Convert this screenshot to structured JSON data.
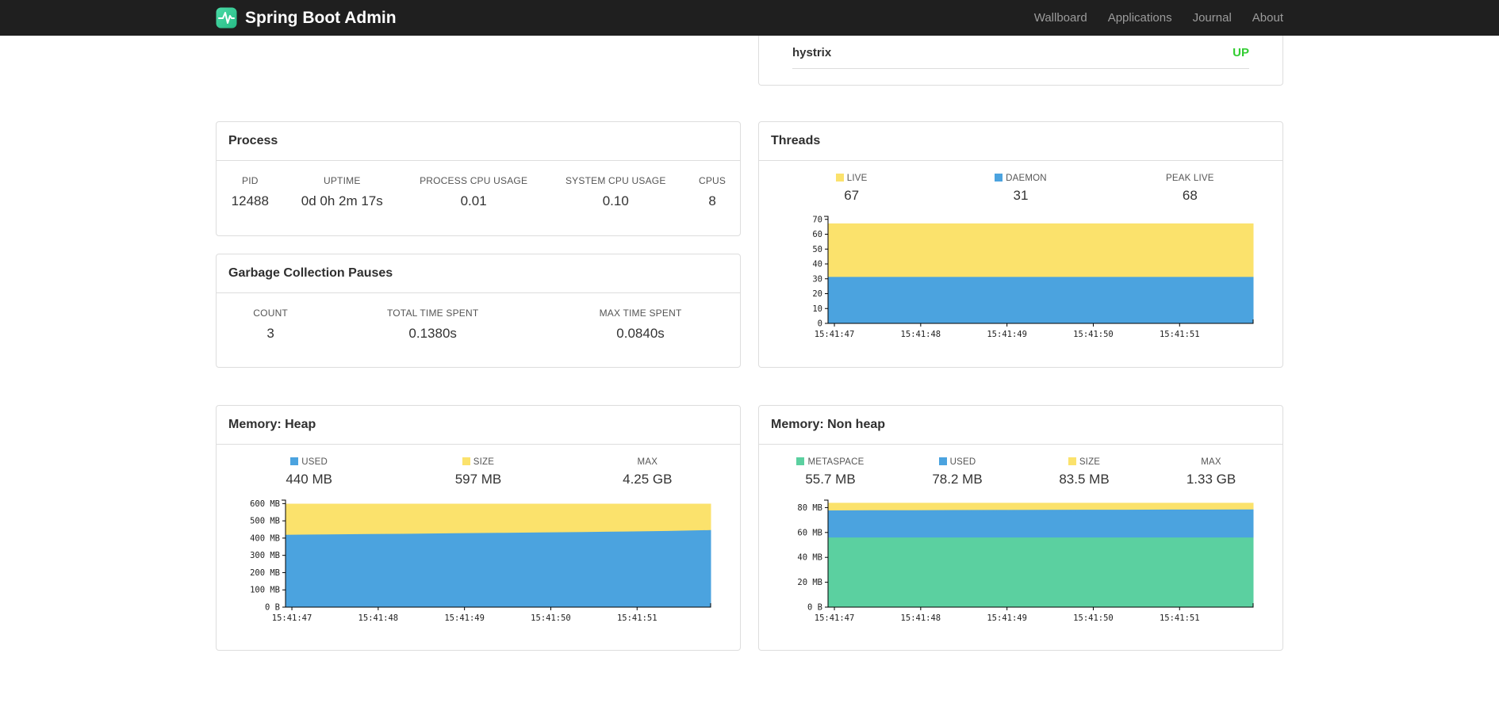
{
  "colors": {
    "navbar_bg": "#1f1f1f",
    "status_up": "#32CD32",
    "panel_border": "#dddddd",
    "chart_blue": "#4BA3DF",
    "chart_yellow": "#FBE26C",
    "chart_green": "#5BD0A0"
  },
  "navbar": {
    "brand": "Spring Boot Admin",
    "links": [
      {
        "label": "Wallboard"
      },
      {
        "label": "Applications"
      },
      {
        "label": "Journal"
      },
      {
        "label": "About"
      }
    ]
  },
  "health_panel": {
    "items": [
      {
        "name": "hystrix",
        "status": "UP"
      }
    ]
  },
  "process_panel": {
    "title": "Process",
    "stats": [
      {
        "label": "PID",
        "value": "12488"
      },
      {
        "label": "UPTIME",
        "value": "0d 0h 2m 17s"
      },
      {
        "label": "PROCESS CPU USAGE",
        "value": "0.01"
      },
      {
        "label": "SYSTEM CPU USAGE",
        "value": "0.10"
      },
      {
        "label": "CPUS",
        "value": "8"
      }
    ]
  },
  "gc_panel": {
    "title": "Garbage Collection Pauses",
    "stats": [
      {
        "label": "COUNT",
        "value": "3"
      },
      {
        "label": "TOTAL TIME SPENT",
        "value": "0.1380s"
      },
      {
        "label": "MAX TIME SPENT",
        "value": "0.0840s"
      }
    ]
  },
  "threads_panel": {
    "title": "Threads",
    "legend": [
      {
        "label": "LIVE",
        "value": "67",
        "swatch": "#FBE26C"
      },
      {
        "label": "DAEMON",
        "value": "31",
        "swatch": "#4BA3DF"
      },
      {
        "label": "PEAK LIVE",
        "value": "68"
      }
    ]
  },
  "heap_panel": {
    "title": "Memory: Heap",
    "legend": [
      {
        "label": "USED",
        "value": "440 MB",
        "swatch": "#4BA3DF"
      },
      {
        "label": "SIZE",
        "value": "597 MB",
        "swatch": "#FBE26C"
      },
      {
        "label": "MAX",
        "value": "4.25 GB"
      }
    ]
  },
  "nonheap_panel": {
    "title": "Memory: Non heap",
    "legend": [
      {
        "label": "METASPACE",
        "value": "55.7 MB",
        "swatch": "#5BD0A0"
      },
      {
        "label": "USED",
        "value": "78.2 MB",
        "swatch": "#4BA3DF"
      },
      {
        "label": "SIZE",
        "value": "83.5 MB",
        "swatch": "#FBE26C"
      },
      {
        "label": "MAX",
        "value": "1.33 GB"
      }
    ]
  },
  "chart_data": [
    {
      "id": "threads-chart",
      "type": "area",
      "title": "Threads",
      "legend_position": "top",
      "grid": false,
      "ymax": 72,
      "y_ticks": [
        {
          "v": 0,
          "label": "0"
        },
        {
          "v": 10,
          "label": "10"
        },
        {
          "v": 20,
          "label": "20"
        },
        {
          "v": 30,
          "label": "30"
        },
        {
          "v": 40,
          "label": "40"
        },
        {
          "v": 50,
          "label": "50"
        },
        {
          "v": 60,
          "label": "60"
        },
        {
          "v": 70,
          "label": "70"
        }
      ],
      "x_tick_labels": [
        "15:41:47",
        "15:41:48",
        "15:41:49",
        "15:41:50",
        "15:41:51"
      ],
      "x_tick_fracs": [
        0.015,
        0.218,
        0.421,
        0.624,
        0.827
      ],
      "series": [
        {
          "name": "live",
          "color": "#FBE26C",
          "values": [
            67,
            67,
            67,
            67,
            67,
            67,
            67,
            67,
            67,
            67,
            67
          ]
        },
        {
          "name": "daemon",
          "color": "#4BA3DF",
          "values": [
            31,
            31,
            31,
            31,
            31,
            31,
            31,
            31,
            31,
            31,
            31
          ]
        }
      ]
    },
    {
      "id": "heap-chart",
      "type": "area",
      "title": "Memory: Heap",
      "legend_position": "top",
      "grid": false,
      "ymax": 620,
      "y_ticks": [
        {
          "v": 0,
          "label": "0 B"
        },
        {
          "v": 100,
          "label": "100 MB"
        },
        {
          "v": 200,
          "label": "200 MB"
        },
        {
          "v": 300,
          "label": "300 MB"
        },
        {
          "v": 400,
          "label": "400 MB"
        },
        {
          "v": 500,
          "label": "500 MB"
        },
        {
          "v": 600,
          "label": "600 MB"
        }
      ],
      "x_tick_labels": [
        "15:41:47",
        "15:41:48",
        "15:41:49",
        "15:41:50",
        "15:41:51"
      ],
      "x_tick_fracs": [
        0.015,
        0.218,
        0.421,
        0.624,
        0.827
      ],
      "series": [
        {
          "name": "size",
          "color": "#FBE26C",
          "values": [
            597,
            597,
            597,
            597,
            597,
            597,
            597,
            597,
            597,
            597,
            597
          ]
        },
        {
          "name": "used",
          "color": "#4BA3DF",
          "values": [
            417,
            419,
            421,
            423,
            426,
            428,
            431,
            433,
            436,
            439,
            444
          ]
        }
      ]
    },
    {
      "id": "nonheap-chart",
      "type": "area",
      "title": "Memory: Non heap",
      "legend_position": "top",
      "grid": false,
      "ymax": 86,
      "y_ticks": [
        {
          "v": 0,
          "label": "0 B"
        },
        {
          "v": 20,
          "label": "20 MB"
        },
        {
          "v": 40,
          "label": "40 MB"
        },
        {
          "v": 60,
          "label": "60 MB"
        },
        {
          "v": 80,
          "label": "80 MB"
        }
      ],
      "x_tick_labels": [
        "15:41:47",
        "15:41:48",
        "15:41:49",
        "15:41:50",
        "15:41:51"
      ],
      "x_tick_fracs": [
        0.015,
        0.218,
        0.421,
        0.624,
        0.827
      ],
      "series": [
        {
          "name": "size",
          "color": "#FBE26C",
          "values": [
            83.5,
            83.5,
            83.5,
            83.5,
            83.5,
            83.5,
            83.5,
            83.5,
            83.5,
            83.5,
            83.5
          ]
        },
        {
          "name": "used",
          "color": "#4BA3DF",
          "values": [
            77.4,
            77.5,
            77.6,
            77.7,
            77.8,
            77.9,
            78.0,
            78.0,
            78.1,
            78.1,
            78.2
          ]
        },
        {
          "name": "metaspace",
          "color": "#5BD0A0",
          "values": [
            55.7,
            55.7,
            55.7,
            55.7,
            55.7,
            55.7,
            55.7,
            55.7,
            55.7,
            55.7,
            55.7
          ]
        }
      ]
    }
  ]
}
